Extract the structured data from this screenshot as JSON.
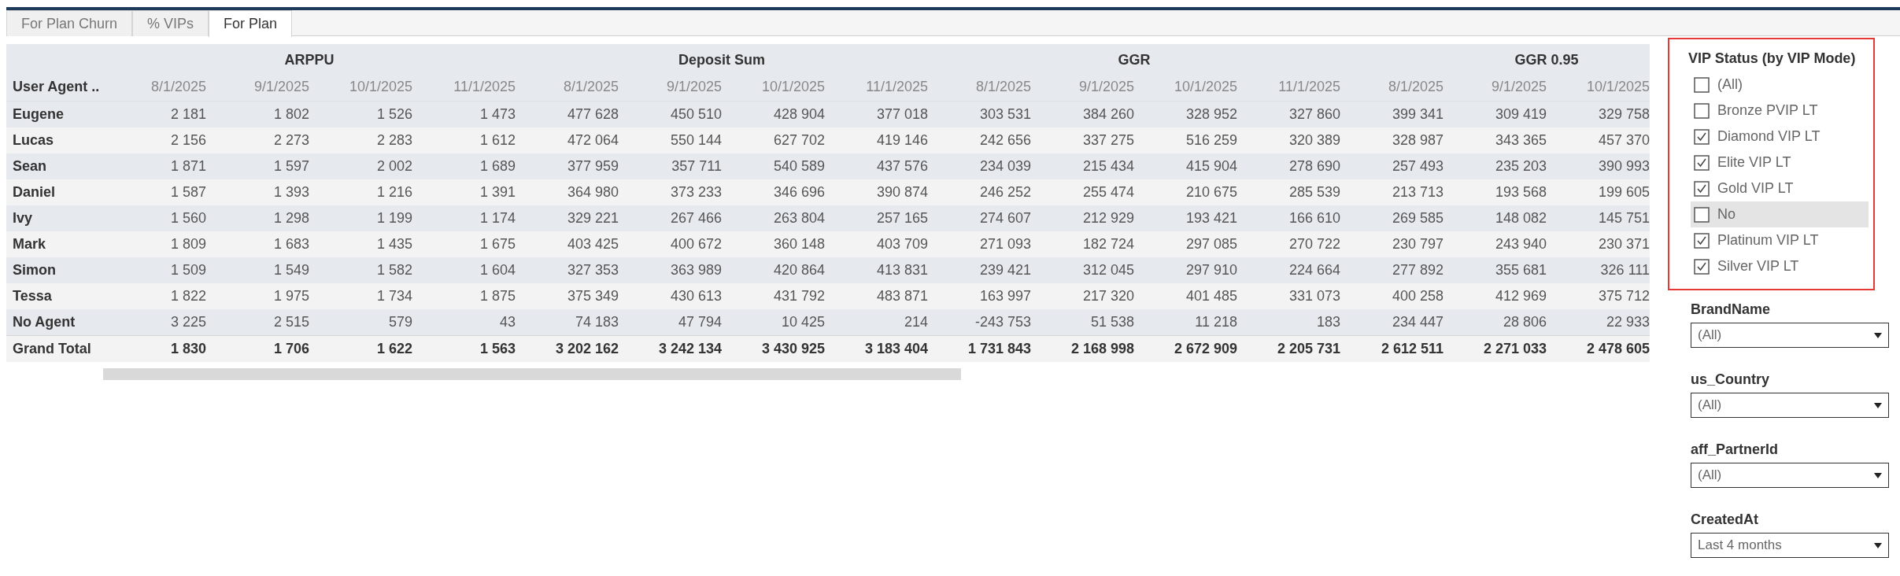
{
  "tabs": [
    {
      "label": "For Plan Churn",
      "selected": false
    },
    {
      "label": "% VIPs",
      "selected": false
    },
    {
      "label": "For Plan",
      "selected": true
    }
  ],
  "table": {
    "row_header": "User Agent ..",
    "groups": [
      {
        "label": "ARPPU",
        "columns": [
          "8/1/2025",
          "9/1/2025",
          "10/1/2025",
          "11/1/2025"
        ]
      },
      {
        "label": "Deposit Sum",
        "columns": [
          "8/1/2025",
          "9/1/2025",
          "10/1/2025",
          "11/1/2025"
        ]
      },
      {
        "label": "GGR",
        "columns": [
          "8/1/2025",
          "9/1/2025",
          "10/1/2025",
          "11/1/2025"
        ]
      },
      {
        "label": "GGR 0.95",
        "columns": [
          "8/1/2025",
          "9/1/2025",
          "10/1/2025"
        ]
      }
    ],
    "rows": [
      {
        "kind": "data",
        "label": "Eugene",
        "values": [
          "2 181",
          "1 802",
          "1 526",
          "1 473",
          "477 628",
          "450 510",
          "428 904",
          "377 018",
          "303 531",
          "384 260",
          "328 952",
          "327 860",
          "399 341",
          "309 419",
          "329 758"
        ]
      },
      {
        "kind": "data",
        "label": "Lucas",
        "values": [
          "2 156",
          "2 273",
          "2 283",
          "1 612",
          "472 064",
          "550 144",
          "627 702",
          "419 146",
          "242 656",
          "337 275",
          "516 259",
          "320 389",
          "328 987",
          "343 365",
          "457 370"
        ]
      },
      {
        "kind": "data",
        "label": "Sean",
        "values": [
          "1 871",
          "1 597",
          "2 002",
          "1 689",
          "377 959",
          "357 711",
          "540 589",
          "437 576",
          "234 039",
          "215 434",
          "415 904",
          "278 690",
          "257 493",
          "235 203",
          "390 993"
        ]
      },
      {
        "kind": "data",
        "label": "Daniel",
        "values": [
          "1 587",
          "1 393",
          "1 216",
          "1 391",
          "364 980",
          "373 233",
          "346 696",
          "390 874",
          "246 252",
          "255 474",
          "210 675",
          "285 539",
          "213 713",
          "193 568",
          "199 605"
        ]
      },
      {
        "kind": "data",
        "label": "Ivy",
        "values": [
          "1 560",
          "1 298",
          "1 199",
          "1 174",
          "329 221",
          "267 466",
          "263 804",
          "257 165",
          "274 607",
          "212 929",
          "193 421",
          "166 610",
          "269 585",
          "148 082",
          "145 751"
        ]
      },
      {
        "kind": "data",
        "label": "Mark",
        "values": [
          "1 809",
          "1 683",
          "1 435",
          "1 675",
          "403 425",
          "400 672",
          "360 148",
          "403 709",
          "271 093",
          "182 724",
          "297 085",
          "270 722",
          "230 797",
          "243 940",
          "230 371"
        ]
      },
      {
        "kind": "data",
        "label": "Simon",
        "values": [
          "1 509",
          "1 549",
          "1 582",
          "1 604",
          "327 353",
          "363 989",
          "420 864",
          "413 831",
          "239 421",
          "312 045",
          "297 910",
          "224 664",
          "277 892",
          "355 681",
          "326 111"
        ]
      },
      {
        "kind": "data",
        "label": "Tessa",
        "values": [
          "1 822",
          "1 975",
          "1 734",
          "1 875",
          "375 349",
          "430 613",
          "431 792",
          "483 871",
          "163 997",
          "217 320",
          "401 485",
          "331 073",
          "400 258",
          "412 969",
          "375 712"
        ]
      },
      {
        "kind": "data",
        "label": "No Agent",
        "values": [
          "3 225",
          "2 515",
          "579",
          "43",
          "74 183",
          "47 794",
          "10 425",
          "214",
          "-243 753",
          "51 538",
          "11 218",
          "183",
          "234 447",
          "28 806",
          "22 933"
        ]
      },
      {
        "kind": "total",
        "label": "Grand Total",
        "values": [
          "1 830",
          "1 706",
          "1 622",
          "1 563",
          "3 202 162",
          "3 242 134",
          "3 430 925",
          "3 183 404",
          "1 731 843",
          "2 168 998",
          "2 672 909",
          "2 205 731",
          "2 612 511",
          "2 271 033",
          "2 478 605"
        ]
      }
    ]
  },
  "filters": [
    {
      "kind": "checklist",
      "title": "VIP Status (by VIP Mode)",
      "outlined": true,
      "items": [
        {
          "label": "(All)",
          "checked": false,
          "highlighted": false
        },
        {
          "label": "Bronze PVIP LT",
          "checked": false,
          "highlighted": false
        },
        {
          "label": "Diamond VIP LT",
          "checked": true,
          "highlighted": false
        },
        {
          "label": "Elite VIP LT",
          "checked": true,
          "highlighted": false
        },
        {
          "label": "Gold VIP LT",
          "checked": true,
          "highlighted": false
        },
        {
          "label": "No",
          "checked": false,
          "highlighted": true
        },
        {
          "label": "Platinum VIP LT",
          "checked": true,
          "highlighted": false
        },
        {
          "label": "Silver VIP LT",
          "checked": true,
          "highlighted": false
        }
      ]
    },
    {
      "kind": "dropdown",
      "title": "BrandName",
      "value": "(All)"
    },
    {
      "kind": "dropdown",
      "title": "us_Country",
      "value": "(All)"
    },
    {
      "kind": "dropdown",
      "title": "aff_PartnerId",
      "value": "(All)"
    },
    {
      "kind": "dropdown",
      "title": "CreatedAt",
      "value": "Last 4 months"
    }
  ]
}
